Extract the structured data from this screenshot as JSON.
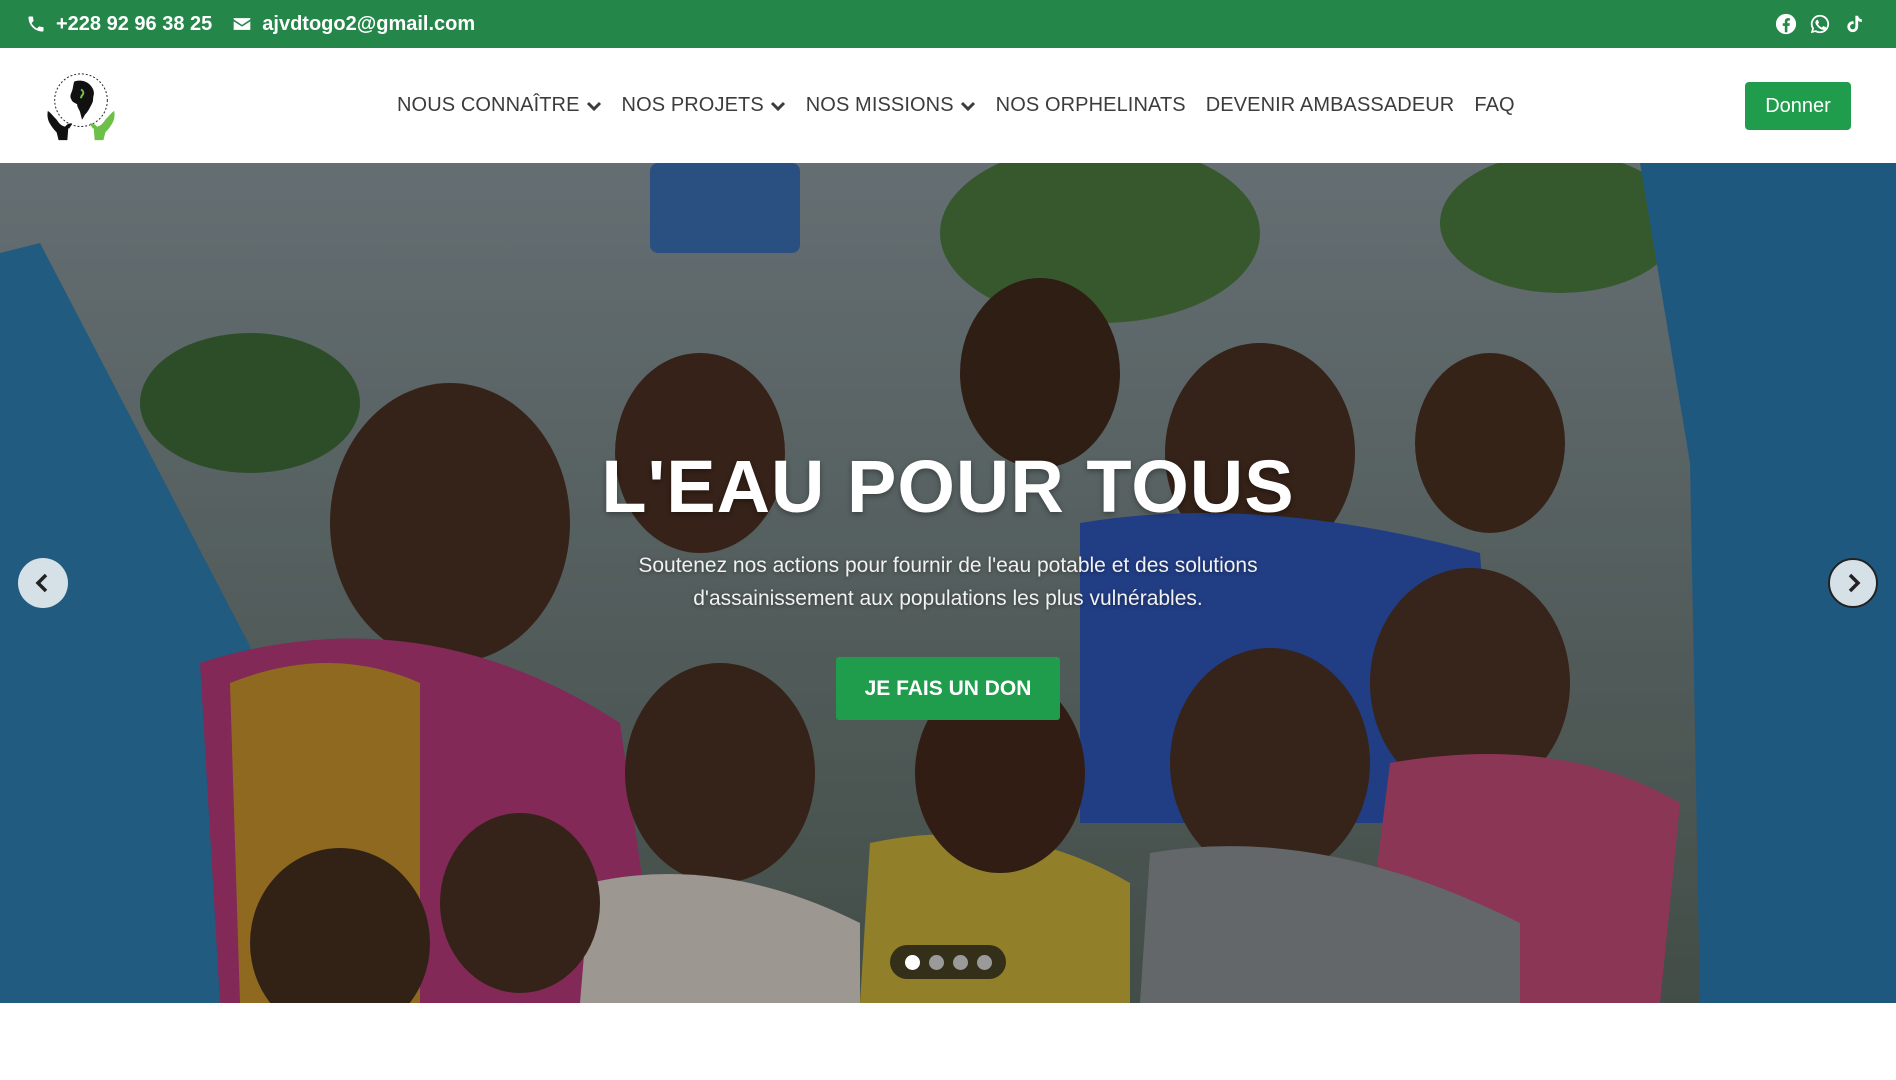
{
  "topbar": {
    "phone": "+228 92 96 38 25",
    "email": "ajvdtogo2@gmail.com",
    "icons": {
      "phone": "phone-icon",
      "email": "envelope-icon"
    },
    "socials": [
      {
        "name": "facebook",
        "icon": "facebook-icon"
      },
      {
        "name": "whatsapp",
        "icon": "whatsapp-icon"
      },
      {
        "name": "tiktok",
        "icon": "tiktok-icon"
      }
    ],
    "bg_color": "#25864a"
  },
  "navbar": {
    "logo_icon": "africa-hands-logo",
    "items": [
      {
        "label": "NOUS CONNAÎTRE",
        "has_dropdown": true
      },
      {
        "label": "NOS PROJETS",
        "has_dropdown": true
      },
      {
        "label": "NOS MISSIONS",
        "has_dropdown": true
      },
      {
        "label": "NOS ORPHELINATS",
        "has_dropdown": false
      },
      {
        "label": "DEVENIR AMBASSADEUR",
        "has_dropdown": false
      },
      {
        "label": "FAQ",
        "has_dropdown": false
      }
    ],
    "donate_label": "Donner",
    "accent_color": "#1f9d4c"
  },
  "hero": {
    "title": "L'EAU POUR TOUS",
    "text": "Soutenez nos actions pour fournir de l'eau potable et des solutions d'assainissement aux populations les plus vulnérables.",
    "cta_label": "JE FAIS UN DON",
    "slides_total": 4,
    "active_slide": 1
  }
}
